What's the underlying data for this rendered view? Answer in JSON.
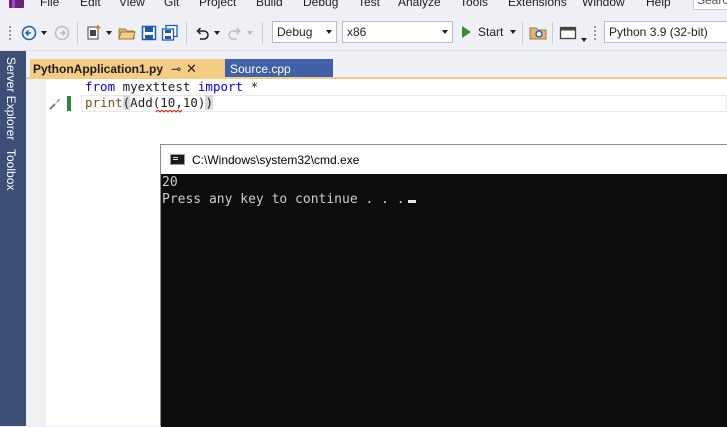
{
  "menu": {
    "items": [
      "File",
      "Edit",
      "View",
      "Git",
      "Project",
      "Build",
      "Debug",
      "Test",
      "Analyze",
      "Tools",
      "Extensions",
      "Window",
      "Help"
    ],
    "search_placeholder": "Searc"
  },
  "toolbar": {
    "configuration": "Debug",
    "platform": "x86",
    "start_label": "Start",
    "python_env": "Python 3.9 (32-bit)"
  },
  "side_panel": {
    "tabs": [
      "Server Explorer",
      "Toolbox"
    ]
  },
  "tabs": [
    {
      "label": "PythonApplication1.py",
      "pin": "⊸",
      "close": "✕"
    },
    {
      "label": "Source.cpp"
    }
  ],
  "code": {
    "line1": {
      "kw1": "from",
      "mod": " myexttest ",
      "kw2": "import",
      "rest": " *"
    },
    "line2": {
      "fn": "print",
      "open": "(",
      "call": "Add(10,10)",
      "close": ")"
    }
  },
  "console": {
    "title": "C:\\Windows\\system32\\cmd.exe",
    "lines": [
      "20",
      "Press any key to continue . . ."
    ]
  },
  "colors": {
    "accent_tab": "#f5cc84",
    "side_strip": "#3d4f77",
    "inactive_tab": "#4060a8",
    "keyword": "#0000ff",
    "console_bg": "#0c0c0c"
  }
}
